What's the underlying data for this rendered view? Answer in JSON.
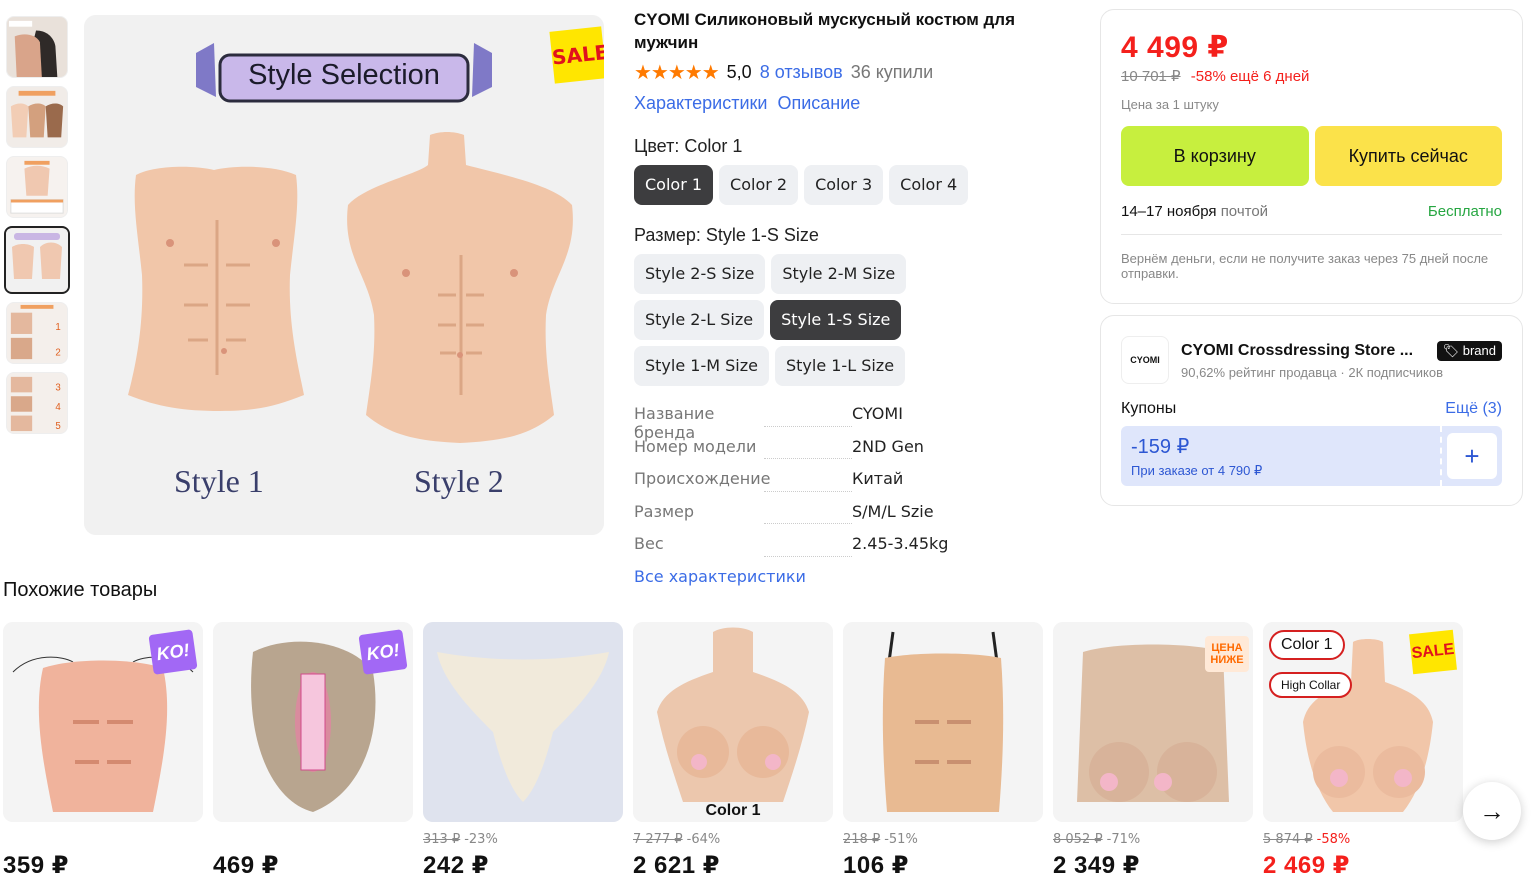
{
  "product": {
    "title": "CYOMI Силиконовый мускусный костюм для мужчин",
    "rating": "5,0",
    "reviews": "8 отзывов",
    "bought": "36 купили",
    "tab_characteristics": "Характеристики",
    "tab_description": "Описание",
    "sale_badge": "SALE",
    "image_banner": "Style Selection",
    "image_style1": "Style 1",
    "image_style2": "Style 2",
    "color_label": "Цвет: Color 1",
    "colors": [
      "Color 1",
      "Color 2",
      "Color 3",
      "Color 4"
    ],
    "size_label": "Размер: Style 1-S Size",
    "sizes": [
      "Style 2-S Size",
      "Style 2-M Size",
      "Style 2-L Size",
      "Style 1-S Size",
      "Style 1-M Size",
      "Style 1-L Size"
    ],
    "specs": [
      {
        "key": "Название бренда",
        "value": "CYOMI"
      },
      {
        "key": "Номер модели",
        "value": "2ND Gen"
      },
      {
        "key": "Происхождение",
        "value": "Китай"
      },
      {
        "key": "Размер",
        "value": "S/M/L Szie"
      },
      {
        "key": "Вес",
        "value": "2.45-3.45kg"
      }
    ],
    "all_specs": "Все характеристики"
  },
  "buy": {
    "price": "4 499 ₽",
    "old_price": "10 701 ₽",
    "discount": "-58% ещё 6 дней",
    "per_unit": "Цена за 1 штуку",
    "cart_button": "В корзину",
    "buy_button": "Купить сейчас",
    "delivery_dates": "14–17 ноября",
    "delivery_method": "почтой",
    "delivery_cost": "Бесплатно",
    "refund": "Вернём деньги, если не получите заказ через 75 дней после отправки."
  },
  "seller": {
    "logo": "CYOMI",
    "name": "CYOMI Crossdressing Store ...",
    "brand_tag": "brand",
    "meta": "90,62% рейтинг продавца  ·  2К подписчиков",
    "coupons_label": "Купоны",
    "coupons_more": "Ещё (3)",
    "coupon_value": "-159 ₽",
    "coupon_condition": "При заказе от 4 790 ₽"
  },
  "similar": {
    "title": "Похожие товары",
    "items": [
      {
        "old": "",
        "discount": "",
        "price": "359 ₽",
        "badge": "KO!"
      },
      {
        "old": "",
        "discount": "",
        "price": "469 ₽",
        "badge": "KO!"
      },
      {
        "old": "313 ₽",
        "discount": "-23%",
        "price": "242 ₽",
        "badge": ""
      },
      {
        "old": "7 277 ₽",
        "discount": "-64%",
        "price": "2 621 ₽",
        "badge": "",
        "caption": "Color 1"
      },
      {
        "old": "218 ₽",
        "discount": "-51%",
        "price": "106 ₽",
        "badge": ""
      },
      {
        "old": "8 052 ₽",
        "discount": "-71%",
        "price": "2 349 ₽",
        "badge": "ЦЕНА НИЖЕ"
      },
      {
        "old": "5 874 ₽",
        "discount": "-58%",
        "price": "2 469 ₽",
        "badge": "SALE",
        "pill1": "Color 1",
        "pill2": "High Collar"
      }
    ]
  },
  "colors": {
    "accent_red": "#f4201c",
    "link_blue": "#3b6ce6",
    "cart_green": "#c7ef3e",
    "buy_yellow": "#fbe24a",
    "star_orange": "#ff7a00"
  }
}
